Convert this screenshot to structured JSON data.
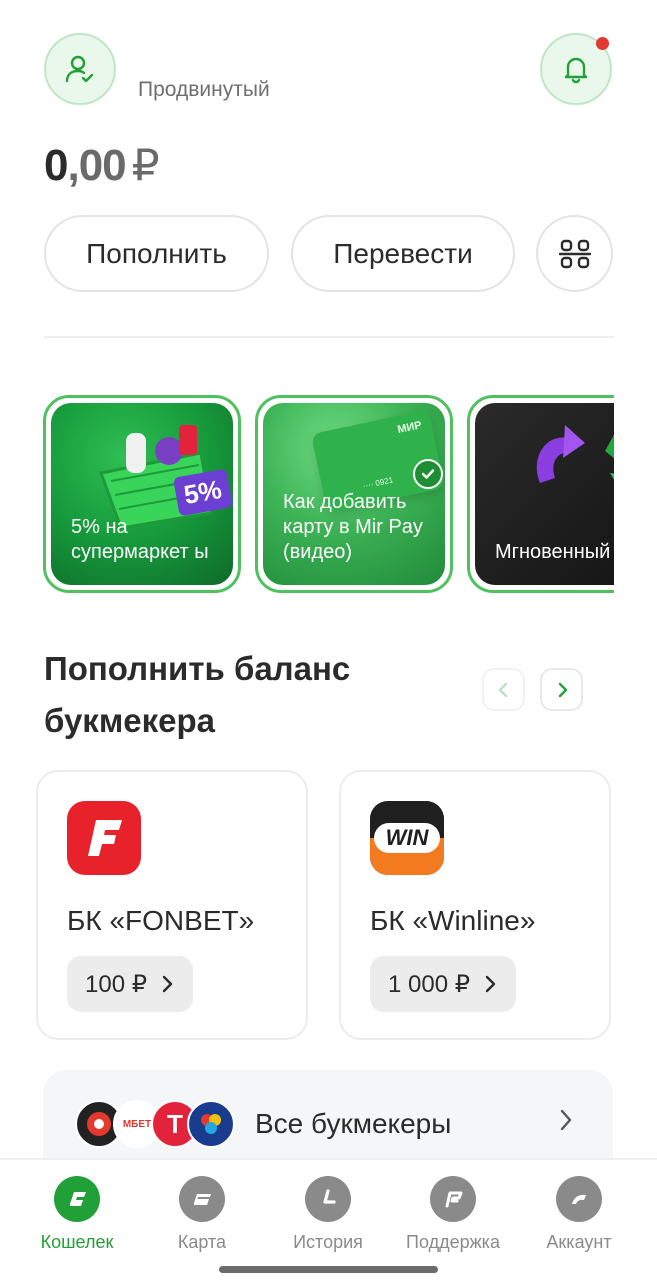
{
  "header": {
    "status_label": "Продвинутый",
    "notification_dot_color": "#e23a2e"
  },
  "balance": {
    "integer": "0",
    "decimal": ",00",
    "currency": "₽"
  },
  "actions": {
    "topup_label": "Пополнить",
    "transfer_label": "Перевести",
    "qr_icon": "qr-scan-icon"
  },
  "stories": [
    {
      "text": "5% на супермаркет ы",
      "badge": "5%"
    },
    {
      "text": "Как добавить карту в Mir Pay (видео)",
      "card_number": "···· 0921",
      "card_brand": "МИР"
    },
    {
      "text": "Мгновенный платеж"
    }
  ],
  "bookmakers_section": {
    "title": "Пополнить баланс букмекера",
    "items": [
      {
        "name": "БК «FONBET»",
        "amount": "100 ₽",
        "logo_color": "#e8222a"
      },
      {
        "name": "БК «Winline»",
        "amount": "1 000 ₽",
        "logo_color": "#f47a20",
        "logo_text": "WIN"
      }
    ],
    "all_label": "Все букмекеры",
    "mini_logo_texts": [
      "МБЕТ",
      "Т"
    ]
  },
  "tabbar": {
    "tabs": [
      {
        "label": "Кошелек",
        "active": true
      },
      {
        "label": "Карта",
        "active": false
      },
      {
        "label": "История",
        "active": false
      },
      {
        "label": "Поддержка",
        "active": false
      },
      {
        "label": "Аккаунт",
        "active": false
      }
    ]
  },
  "colors": {
    "accent": "#21a038",
    "accent_light": "#eaf8ec"
  }
}
